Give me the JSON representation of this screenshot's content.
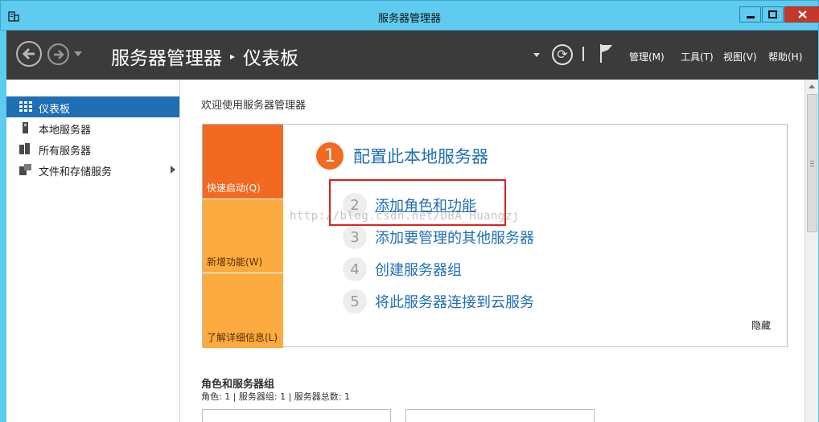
{
  "window": {
    "title": "服务器管理器",
    "icons": {
      "app": "server-manager-icon",
      "minimize": "minimize-icon",
      "maximize": "maximize-icon",
      "close": "close-icon"
    }
  },
  "header": {
    "breadcrumb": [
      "服务器管理器",
      "仪表板"
    ],
    "menu": [
      "管理(M)",
      "工具(T)",
      "视图(V)",
      "帮助(H)"
    ],
    "icons": {
      "back": "back-arrow-icon",
      "forward": "forward-arrow-icon",
      "refresh": "refresh-icon",
      "flag": "flag-icon"
    }
  },
  "sidebar": {
    "items": [
      {
        "label": "仪表板",
        "icon": "dashboard-icon",
        "active": true
      },
      {
        "label": "本地服务器",
        "icon": "local-server-icon"
      },
      {
        "label": "所有服务器",
        "icon": "all-servers-icon"
      },
      {
        "label": "文件和存储服务",
        "icon": "file-storage-icon"
      }
    ]
  },
  "main": {
    "welcome": "欢迎使用服务器管理器",
    "tiles": [
      "快速启动(Q)",
      "新增功能(W)",
      "了解详细信息(L)"
    ],
    "steps": [
      {
        "num": "1",
        "label": "配置此本地服务器"
      },
      {
        "num": "2",
        "label": "添加角色和功能"
      },
      {
        "num": "3",
        "label": "添加要管理的其他服务器"
      },
      {
        "num": "4",
        "label": "创建服务器组"
      },
      {
        "num": "5",
        "label": "将此服务器连接到云服务"
      }
    ],
    "watermark": "http://blog.csdn.net/DBA_Huangzj",
    "hide_link": "隐藏",
    "roles_title": "角色和服务器组",
    "roles_summary": "角色: 1 | 服务器组: 1 | 服务器总数: 1"
  },
  "colors": {
    "titlebar": "#5ecbef",
    "header": "#3b3b3b",
    "accent": "#1f6fb5",
    "tile_orange": "#f26a22",
    "tile_yellow": "#fbab3f",
    "close": "#c7382b",
    "highlight_box": "#d9221f"
  }
}
